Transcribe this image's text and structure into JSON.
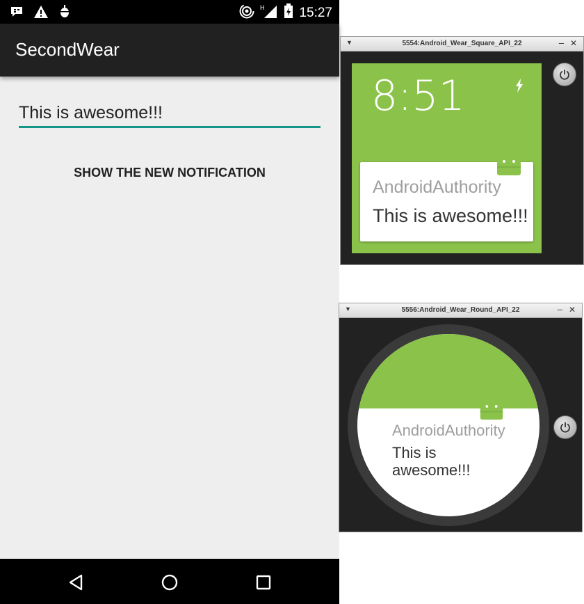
{
  "phone": {
    "status": {
      "time": "15:27"
    },
    "app_title": "SecondWear",
    "text_field_value": "This is awesome!!!",
    "button_label": "SHOW THE NEW NOTIFICATION"
  },
  "square_emulator": {
    "window_title": "5554:Android_Wear_Square_API_22",
    "clock": "8:51",
    "notification": {
      "app": "AndroidAuthority",
      "text": "This is awesome!!!"
    }
  },
  "round_emulator": {
    "window_title": "5556:Android_Wear_Round_API_22",
    "notification": {
      "app": "AndroidAuthority",
      "text": "This is awesome!!!"
    }
  },
  "colors": {
    "accent_teal": "#159688",
    "wear_green": "#8bc34a",
    "appbar": "#212121"
  }
}
